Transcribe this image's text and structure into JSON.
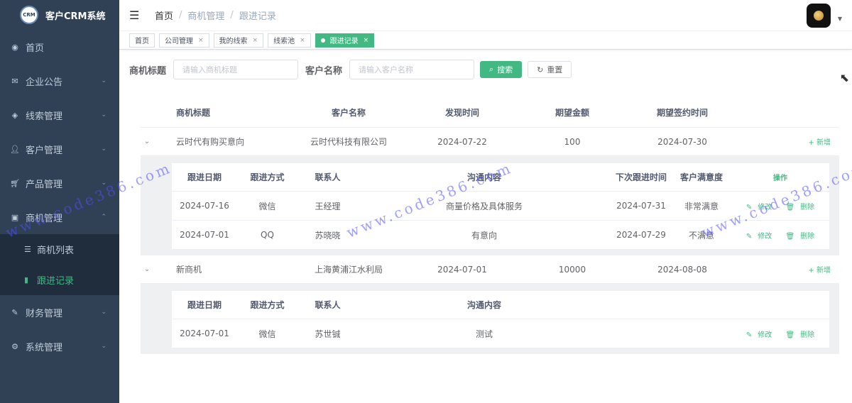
{
  "brand": {
    "logo": "CRM",
    "title": "客户CRM系统"
  },
  "sidebar": {
    "items": [
      {
        "icon": "dashboard-icon",
        "label": "首页"
      },
      {
        "icon": "mail-icon",
        "label": "企业公告"
      },
      {
        "icon": "layers-icon",
        "label": "线索管理"
      },
      {
        "icon": "user-icon",
        "label": "客户管理"
      },
      {
        "icon": "cart-icon",
        "label": "产品管理"
      },
      {
        "icon": "chart-icon",
        "label": "商机管理"
      },
      {
        "icon": "edit-icon",
        "label": "财务管理"
      },
      {
        "icon": "gear-icon",
        "label": "系统管理"
      }
    ],
    "sub": [
      {
        "icon": "list-icon",
        "label": "商机列表"
      },
      {
        "icon": "book-icon",
        "label": "跟进记录"
      }
    ]
  },
  "breadcrumb": [
    "首页",
    "商机管理",
    "跟进记录"
  ],
  "tags": [
    "首页",
    "公司管理",
    "我的线索",
    "线索池",
    "跟进记录"
  ],
  "search": {
    "title_label": "商机标题",
    "title_placeholder": "请输入商机标题",
    "customer_label": "客户名称",
    "customer_placeholder": "请输入客户名称",
    "search_btn": "搜索",
    "reset_btn": "重置"
  },
  "table": {
    "headers": [
      "商机标题",
      "客户名称",
      "发现时间",
      "期望金额",
      "期望签约时间"
    ],
    "add_label": "新增",
    "rows": [
      {
        "title": "云时代有购买意向",
        "customer": "云时代科技有限公司",
        "found": "2024-07-22",
        "amount": "100",
        "sign": "2024-07-30"
      },
      {
        "title": "新商机",
        "customer": "上海黄浦江水利局",
        "found": "2024-07-01",
        "amount": "10000",
        "sign": "2024-08-08"
      }
    ]
  },
  "followup": {
    "headers": [
      "跟进日期",
      "跟进方式",
      "联系人",
      "沟通内容",
      "下次跟进时间",
      "客户满意度",
      "操作"
    ],
    "headers_short": [
      "跟进日期",
      "跟进方式",
      "联系人",
      "沟通内容"
    ],
    "edit_label": "修改",
    "delete_label": "删除",
    "group1": [
      {
        "date": "2024-07-16",
        "way": "微信",
        "person": "王经理",
        "content": "商量价格及具体服务",
        "next": "2024-07-31",
        "sat": "非常满意"
      },
      {
        "date": "2024-07-01",
        "way": "QQ",
        "person": "苏晓晓",
        "content": "有意向",
        "next": "2024-07-29",
        "sat": "不满意"
      }
    ],
    "group2": [
      {
        "date": "2024-07-01",
        "way": "微信",
        "person": "苏世铖",
        "content": "测试"
      }
    ]
  },
  "watermark": "www.code386.com"
}
